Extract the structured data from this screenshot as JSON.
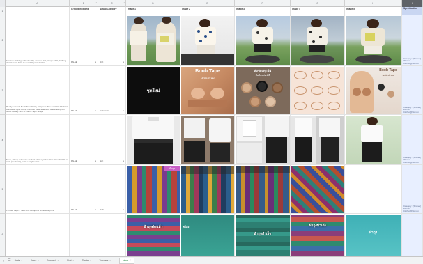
{
  "columns": [
    {
      "letter": "A"
    },
    {
      "letter": "B"
    },
    {
      "letter": "C"
    },
    {
      "letter": "D"
    },
    {
      "letter": "E"
    },
    {
      "letter": "F"
    },
    {
      "letter": "G"
    },
    {
      "letter": "H"
    },
    {
      "letter": "I"
    },
    {
      "letter": "J"
    },
    {
      "letter": "K"
    }
  ],
  "rows": [
    "1",
    "2",
    "3",
    "4",
    "5",
    "6"
  ],
  "header": {
    "is_word_included": "Is word included",
    "actual_category": "Actual Category",
    "image1": "Image 1",
    "image2": "Image 2",
    "image3": "Image 3",
    "image4": "Image 4",
    "image5": "Image 5",
    "specification": "Specification"
  },
  "data_rows": [
    {
      "description": "Fashion clothing, school outfit, woman shirt, simple shirt, knitting shirt Korean Shirt Collar shirt printed shirt",
      "is_word": "FALSE",
      "category": "shirt",
      "spec": "Category : [Shopee] Women Clothes@Women"
    },
    {
      "description": "Ready to send! Boob Tape Sticky Strapless Tape Lift With Medical Adhesive Tape Strong Invisible Tape Seamless and Waterproof Good Quality With 4 Colors Tape Shape",
      "is_word": "FALSE",
      "category": "underwear",
      "spec": "Category : [Shopee] Women Clothes@Women"
    },
    {
      "description": "Minis, Shoop 7 Female student skirt, cylinder skirts 13 inch skirt tie suits (student's), white / bright skirts",
      "is_word": "FALSE",
      "category": "skirt",
      "spec": "Category : [Shopee] Women Clothes@Women"
    },
    {
      "description": "1 meter bags 1 Sets and Set up the wholesale price",
      "is_word": "FALSE",
      "category": "cloth",
      "spec": "Category : [Shopee] Women Clothes@Women"
    },
    {
      "description": "",
      "is_word": "",
      "category": "",
      "spec": ""
    }
  ],
  "image_texts": {
    "r2c1": "ชุดใหม่",
    "r2c2": "Boob Tape",
    "r2c2b": "เทปแปะนม",
    "r2c3": "ส่งของทุกวัน",
    "r2c3b": "มีพร้อมส่ง 4 สี",
    "r2c5": "Boob Tape",
    "r2c5b": "เทปแปะนม",
    "r4c1": "ผ้าถุง",
    "r5c1": "ผ้าถุงตัดแล้ว",
    "r5c2": "ฟรีส่ง",
    "r5c3": "ผ้าถุงสำเร็จ",
    "r5c4": "ผ้าถุงปาเต๊ะ",
    "r5c5": "ผ้าถุง"
  },
  "tabs": [
    {
      "label": "shirts"
    },
    {
      "label": "Dress"
    },
    {
      "label": "Jumpsuit"
    },
    {
      "label": "Skirt"
    },
    {
      "label": "Denim"
    },
    {
      "label": "Trousers"
    },
    {
      "label": "other"
    }
  ],
  "colors": {
    "sheets_green": "#188038",
    "spec_bg": "#e8efff",
    "spec_header": "#c9d6f2",
    "grid_line": "#e2e2e2"
  },
  "icons": [
    "add-sheet-icon",
    "all-sheets-icon",
    "chevron-down-icon"
  ]
}
